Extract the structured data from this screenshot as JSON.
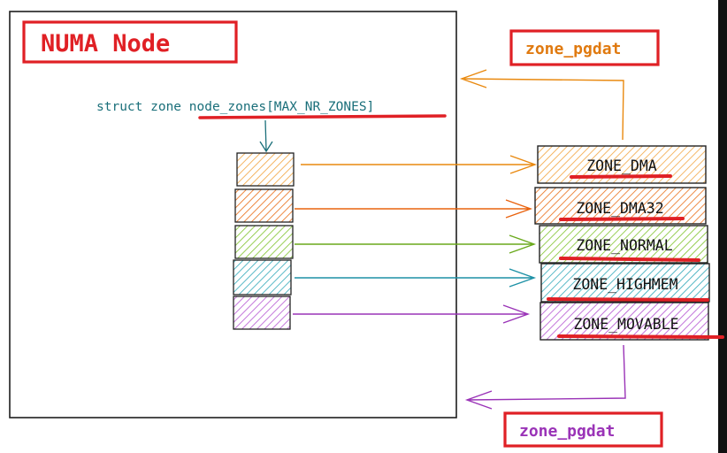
{
  "node": {
    "title": "NUMA Node",
    "array_label_prefix": "struct zone ",
    "array_label_name": "node_zones[MAX_NR_ZONES]"
  },
  "pgdat_top": "zone_pgdat",
  "pgdat_bottom": "zone_pgdat",
  "zones": [
    {
      "label": "ZONE_DMA",
      "color": "#f2a541"
    },
    {
      "label": "ZONE_DMA32",
      "color": "#e96e17"
    },
    {
      "label": "ZONE_NORMAL",
      "color": "#7fc32b"
    },
    {
      "label": "ZONE_HIGHMEM",
      "color": "#2ea7b8"
    },
    {
      "label": "ZONE_MOVABLE",
      "color": "#b453d1"
    }
  ],
  "colors": {
    "highlight_red": "#e02025",
    "label_teal": "#1a6f7a",
    "pgdat_top_text": "#e07a10",
    "pgdat_bottom_text": "#9a33b7",
    "node_title_text": "#e02025"
  }
}
